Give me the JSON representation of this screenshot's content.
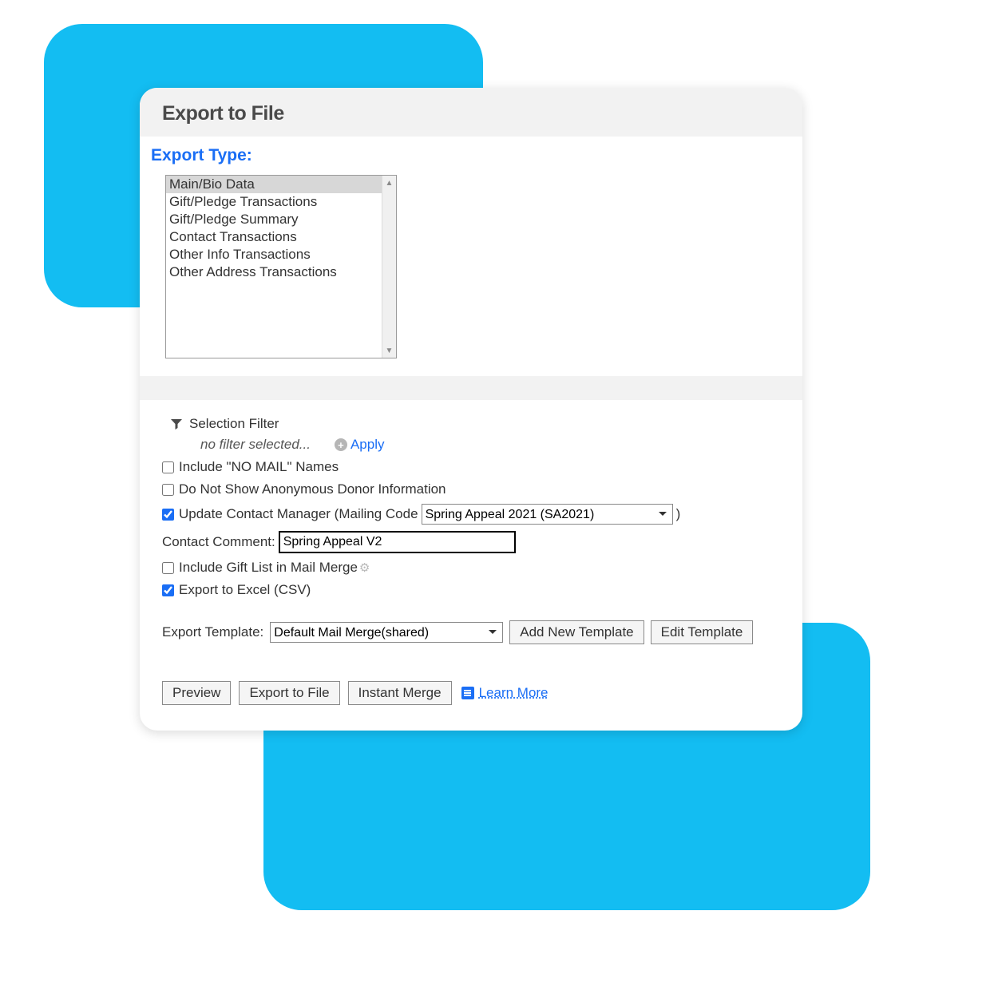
{
  "panel": {
    "title": "Export to File",
    "export_type_label": "Export Type:",
    "listbox": {
      "items": [
        "Main/Bio Data",
        "Gift/Pledge Transactions",
        "Gift/Pledge Summary",
        "Contact Transactions",
        "Other Info Transactions",
        "Other Address Transactions"
      ],
      "selected_index": 0
    }
  },
  "filter": {
    "label": "Selection Filter",
    "none_text": "no filter selected...",
    "apply_label": "Apply"
  },
  "options": {
    "include_no_mail": {
      "label": "Include \"NO MAIL\" Names",
      "checked": false
    },
    "hide_anonymous": {
      "label": "Do Not Show Anonymous Donor Information",
      "checked": false
    },
    "update_contact": {
      "label": "Update Contact Manager (Mailing Code",
      "checked": true,
      "selected": "Spring Appeal 2021 (SA2021)",
      "closing_paren": ")"
    },
    "contact_comment": {
      "label": "Contact Comment:",
      "value": "Spring Appeal V2"
    },
    "include_gift_list": {
      "label": "Include Gift List in Mail Merge",
      "checked": false
    },
    "export_csv": {
      "label": "Export to Excel (CSV)",
      "checked": true
    }
  },
  "template": {
    "label": "Export Template:",
    "selected": "Default Mail Merge(shared)",
    "add_button": "Add New Template",
    "edit_button": "Edit Template"
  },
  "actions": {
    "preview": "Preview",
    "export": "Export to File",
    "merge": "Instant Merge",
    "learn_more": "Learn More"
  }
}
